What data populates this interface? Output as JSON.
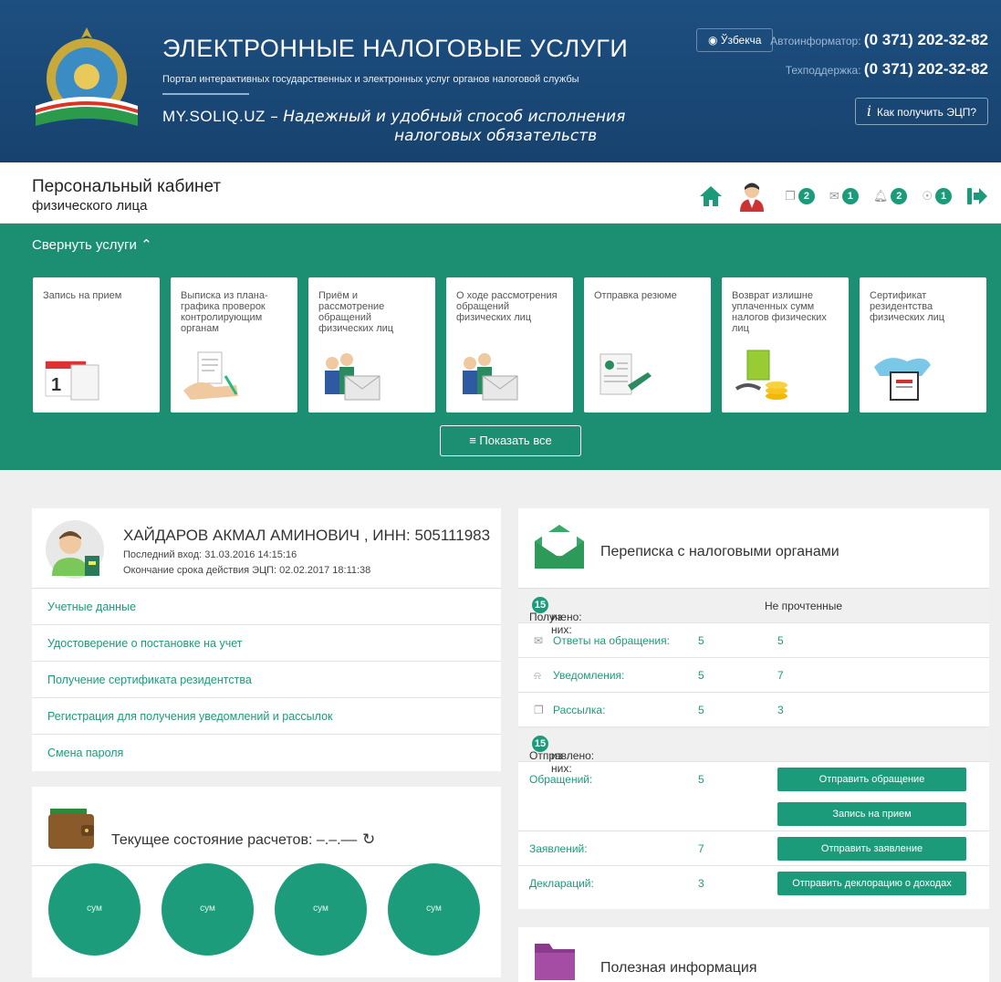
{
  "header": {
    "title": "ЭЛЕКТРОННЫЕ НАЛОГОВЫЕ УСЛУГИ",
    "subtitle": "Портал интерактивных государственных и электронных услуг органов налоговой службы",
    "site": "MY.SOLIQ.UZ",
    "slogan_part1": " – Надежный и удобный способ исполнения",
    "slogan_part2": "налоговых обязательств",
    "language": "Ўзбекча",
    "autoinfo_label": "Автоинформатор:",
    "autoinfo_phone": "(0 371) 202-32-82",
    "support_label": "Техподдержка:",
    "support_phone": "(0 371) 202-32-82",
    "ecp_button": "Как получить ЭЦП?",
    "brand_color": "#1b4a7a"
  },
  "cabinet": {
    "title": "Персональный кабинет",
    "subtitle": "физического лица",
    "badges": {
      "mail": "2",
      "messages": "1",
      "notifications": "2",
      "tips": "1"
    }
  },
  "services": {
    "collapse_label": "Свернуть услуги",
    "show_all": "Показать все",
    "accent": "#1c8f73",
    "cards": [
      {
        "label": "Запись на прием",
        "icon": "calendar-icon"
      },
      {
        "label": "Выписка из плана-графика проверок контролирующим органам",
        "icon": "document-hand-icon"
      },
      {
        "label": "Приём и рассмотрение обращений физических лиц",
        "icon": "people-mail-icon"
      },
      {
        "label": "О ходе рассмотрения обращений физических лиц",
        "icon": "people-mail-icon"
      },
      {
        "label": "Отправка резюме",
        "icon": "resume-icon"
      },
      {
        "label": "Возврат излишне уплаченных сумм налогов физических лиц",
        "icon": "money-return-icon"
      },
      {
        "label": "Сертификат резидентства физических лиц",
        "icon": "certificate-icon"
      }
    ]
  },
  "user": {
    "name": "ХАЙДАРОВ АКМАЛ АМИНОВИЧ , ИНН: 505111983",
    "last_login": "Последний вход: 31.03.2016 14:15:16",
    "ecp_expiry": "Окончание срока действия ЭЦП: 02.02.2017 18:11:38",
    "links": [
      "Учетные данные",
      "Удостоверение о постановке на учет",
      "Получение сертификата резидентства",
      "Регистрация для получения уведомлений и рассылок",
      "Смена пароля"
    ]
  },
  "payments": {
    "title": "Текущее состояние расчетов: –.–.––",
    "circles": [
      "сум",
      "сум",
      "сум",
      "сум"
    ]
  },
  "correspondence": {
    "title": "Переписка с налоговыми органами",
    "received_label": "Получено:",
    "received_count": "15",
    "received_suffix": "из них:",
    "unread_label": "Не прочтенные",
    "rows": [
      {
        "label": "Ответы на обращения:",
        "total": "5",
        "unread": "5"
      },
      {
        "label": "Уведомления:",
        "total": "5",
        "unread": "7"
      },
      {
        "label": "Рассылка:",
        "total": "5",
        "unread": "3"
      }
    ],
    "sent_label": "Отправлено:",
    "sent_count": "15",
    "sent_suffix": "из них:",
    "sent": {
      "appeals_label": "Обращений:",
      "appeals": "5",
      "btn_appeal": "Отправить обращение",
      "btn_appointment": "Запись на прием",
      "statements_label": "Заявлений:",
      "statements": "7",
      "btn_statement": "Отправить заявление",
      "declarations_label": "Деклараций:",
      "declarations": "3",
      "btn_declaration": "Отправить деклорацию о доходах"
    }
  },
  "info": {
    "title": "Полезная информация"
  }
}
